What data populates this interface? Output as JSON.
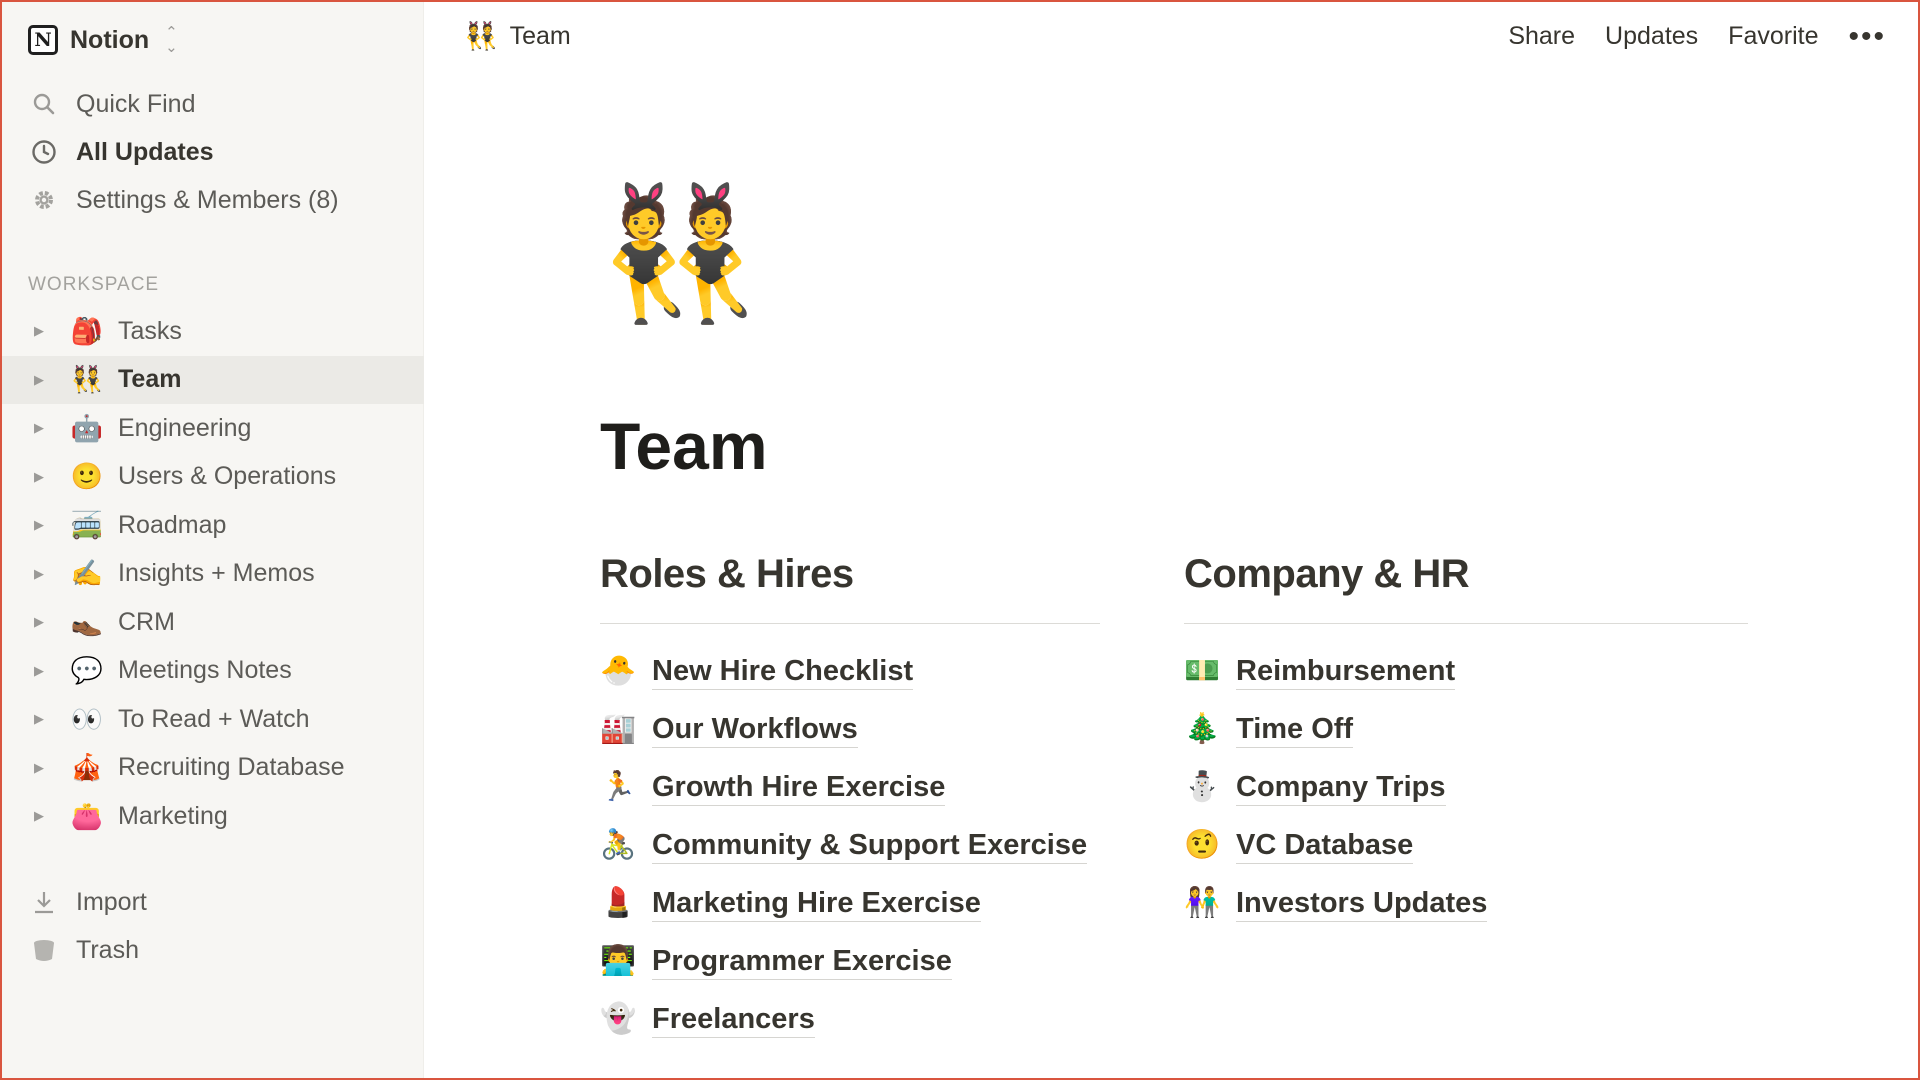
{
  "workspace": {
    "name": "Notion",
    "logo_letter": "N"
  },
  "sidebar": {
    "menu": [
      {
        "label": "Quick Find",
        "icon": "search-icon"
      },
      {
        "label": "All Updates",
        "icon": "clock-icon"
      },
      {
        "label": "Settings & Members (8)",
        "icon": "gear-icon"
      }
    ],
    "section_label": "WORKSPACE",
    "pages": [
      {
        "emoji": "🎒",
        "label": "Tasks"
      },
      {
        "emoji": "👯",
        "label": "Team",
        "active": true
      },
      {
        "emoji": "🤖",
        "label": "Engineering"
      },
      {
        "emoji": "🙂",
        "label": "Users & Operations"
      },
      {
        "emoji": "🚎",
        "label": "Roadmap"
      },
      {
        "emoji": "✍️",
        "label": "Insights + Memos"
      },
      {
        "emoji": "👞",
        "label": "CRM"
      },
      {
        "emoji": "💬",
        "label": "Meetings Notes"
      },
      {
        "emoji": "👀",
        "label": "To Read + Watch"
      },
      {
        "emoji": "🎪",
        "label": "Recruiting Database"
      },
      {
        "emoji": "👛",
        "label": "Marketing"
      }
    ],
    "bottom": [
      {
        "label": "Import",
        "icon": "download-icon"
      },
      {
        "label": "Trash",
        "icon": "trash-icon"
      }
    ]
  },
  "topbar": {
    "breadcrumb": {
      "emoji": "👯",
      "label": "Team"
    },
    "actions": {
      "share": "Share",
      "updates": "Updates",
      "favorite": "Favorite",
      "more": "•••"
    }
  },
  "page": {
    "icon": "👯",
    "title": "Team",
    "columns": [
      {
        "heading": "Roles & Hires",
        "links": [
          {
            "emoji": "🐣",
            "label": "New Hire Checklist"
          },
          {
            "emoji": "🏭",
            "label": "Our Workflows"
          },
          {
            "emoji": "🏃",
            "label": "Growth Hire Exercise"
          },
          {
            "emoji": "🚴",
            "label": "Community & Support Exercise"
          },
          {
            "emoji": "💄",
            "label": "Marketing Hire Exercise"
          },
          {
            "emoji": "👨‍💻",
            "label": "Programmer Exercise"
          },
          {
            "emoji": "👻",
            "label": "Freelancers"
          }
        ]
      },
      {
        "heading": "Company & HR",
        "links": [
          {
            "emoji": "💵",
            "label": "Reimbursement"
          },
          {
            "emoji": "🎄",
            "label": "Time Off"
          },
          {
            "emoji": "⛄",
            "label": "Company Trips"
          },
          {
            "emoji": "🤨",
            "label": "VC Database"
          },
          {
            "emoji": "👫",
            "label": "Investors Updates"
          }
        ]
      }
    ]
  },
  "colors": {
    "sidebar_bg": "#f7f6f3",
    "active_bg": "#ebeae6",
    "text": "#37352f",
    "frame": "#d9553f"
  }
}
